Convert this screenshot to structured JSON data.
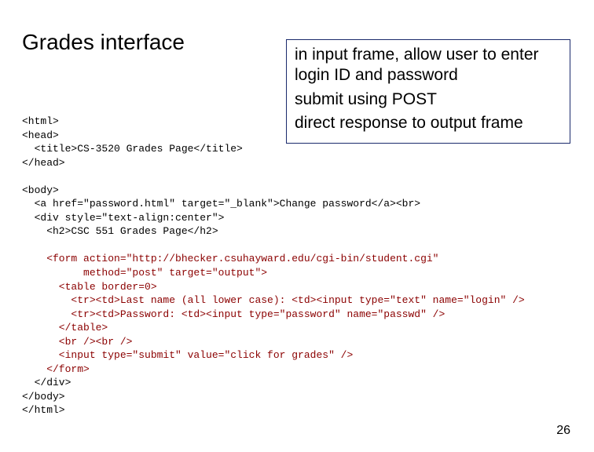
{
  "title": "Grades interface",
  "callout": {
    "line1": "in input frame, allow user to enter login ID and password",
    "line2": "submit using POST",
    "line3": "direct response to output frame"
  },
  "code": {
    "l1": "<html>",
    "l2": "<head>",
    "l3": "  <title>CS-3520 Grades Page</title>",
    "l4": "</head>",
    "l5": "",
    "l6": "<body>",
    "l7": "  <a href=\"password.html\" target=\"_blank\">Change password</a><br>",
    "l8": "  <div style=\"text-align:center\">",
    "l9": "    <h2>CSC 551 Grades Page</h2>",
    "l10": "",
    "l11": "    <form action=\"http://bhecker.csuhayward.edu/cgi-bin/student.cgi\"",
    "l12": "          method=\"post\" target=\"output\">",
    "l13": "      <table border=0>",
    "l14": "        <tr><td>Last name (all lower case): <td><input type=\"text\" name=\"login\" />",
    "l15": "        <tr><td>Password: <td><input type=\"password\" name=\"passwd\" />",
    "l16": "      </table>",
    "l17": "      <br /><br />",
    "l18": "      <input type=\"submit\" value=\"click for grades\" />",
    "l19": "    </form>",
    "l20": "  </div>",
    "l21": "</body>",
    "l22": "</html>"
  },
  "page_number": "26"
}
